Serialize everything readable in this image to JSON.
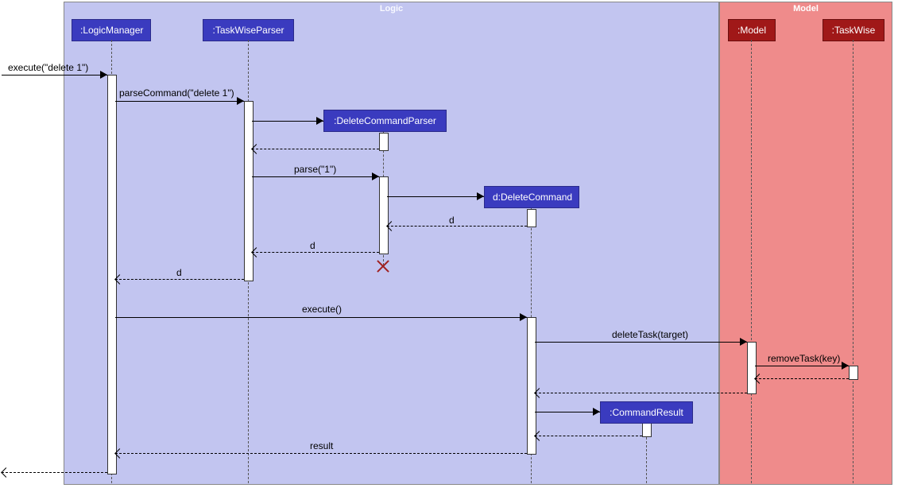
{
  "frames": {
    "logic": "Logic",
    "model": "Model"
  },
  "participants": {
    "logicManager": ":LogicManager",
    "taskWiseParser": ":TaskWiseParser",
    "deleteCommandParser": ":DeleteCommandParser",
    "deleteCommand": "d:DeleteCommand",
    "commandResult": ":CommandResult",
    "model": ":Model",
    "taskWise": ":TaskWise"
  },
  "messages": {
    "execute1": "execute(\"delete 1\")",
    "parseCommand": "parseCommand(\"delete 1\")",
    "parse": "parse(\"1\")",
    "d1": "d",
    "d2": "d",
    "d3": "d",
    "execute2": "execute()",
    "deleteTask": "deleteTask(target)",
    "removeTask": "removeTask(key)",
    "result": "result"
  }
}
